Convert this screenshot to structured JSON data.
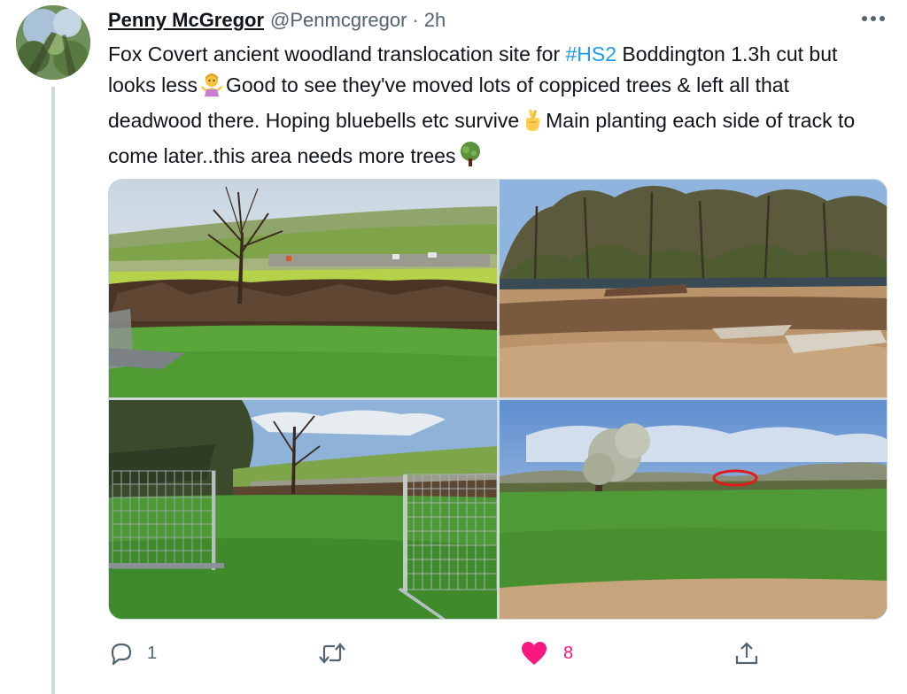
{
  "tweet": {
    "author_name": "Penny McGregor",
    "handle": "@Penmcgregor",
    "separator": "·",
    "time": "2h",
    "text_part1": "Fox Covert ancient woodland translocation site for ",
    "hashtag": "#HS2",
    "text_part2": " Boddington 1.3h cut but looks less",
    "text_part3": "Good to see they've moved lots of coppiced trees & left all that deadwood there. Hoping bluebells etc survive",
    "text_part4": "Main planting each side of track to come later..this area needs more trees",
    "emojis": [
      "person-shrugging-emoji",
      "crossed-fingers-emoji",
      "deciduous-tree-emoji"
    ]
  },
  "media": {
    "count": 4,
    "photos": [
      {
        "name": "photo-cleared-woodland-field"
      },
      {
        "name": "photo-woodland-edge-bare-ground"
      },
      {
        "name": "photo-fence-panels-grass"
      },
      {
        "name": "photo-open-field-red-circle"
      }
    ]
  },
  "actions": {
    "reply_count": "1",
    "retweet_count": "",
    "like_count": "8",
    "like_active": true
  },
  "colors": {
    "accent": "#1d9bf0",
    "like": "#f91880",
    "text_secondary": "#536471",
    "thread_line": "#cfd9de"
  }
}
